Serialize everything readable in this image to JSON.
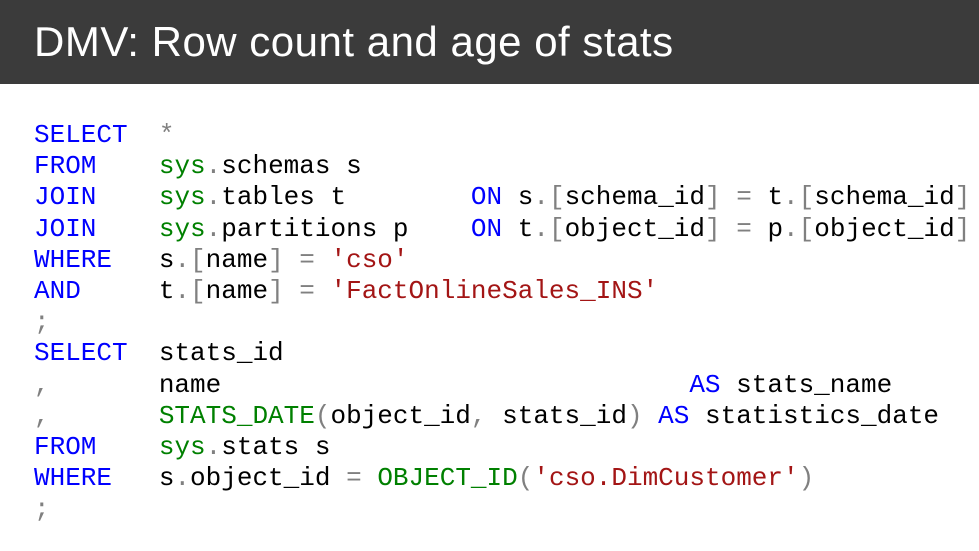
{
  "header": {
    "title": "DMV: Row count and age of stats"
  },
  "code": {
    "lines": [
      {
        "kw": "SELECT",
        "rest": "*"
      },
      {
        "kw": "FROM",
        "rest": "sys.schemas s"
      },
      {
        "kw": "JOIN",
        "rest": "sys.tables t        ON s.[schema_id] = t.[schema_id]"
      },
      {
        "kw": "JOIN",
        "rest": "sys.partitions p    ON t.[object_id] = p.[object_id]"
      },
      {
        "kw": "WHERE",
        "rest": "s.[name] = 'cso'"
      },
      {
        "kw": "AND",
        "rest": "t.[name] = 'FactOnlineSales_INS'"
      },
      {
        "kw": ";",
        "rest": ""
      },
      {
        "kw": "SELECT",
        "rest": "stats_id"
      },
      {
        "kw": ",",
        "rest": "name                              AS stats_name"
      },
      {
        "kw": ",",
        "rest": "STATS_DATE(object_id, stats_id) AS statistics_date"
      },
      {
        "kw": "FROM",
        "rest": "sys.stats s"
      },
      {
        "kw": "WHERE",
        "rest": "s.object_id = OBJECT_ID('cso.DimCustomer')"
      },
      {
        "kw": ";",
        "rest": ""
      }
    ]
  }
}
